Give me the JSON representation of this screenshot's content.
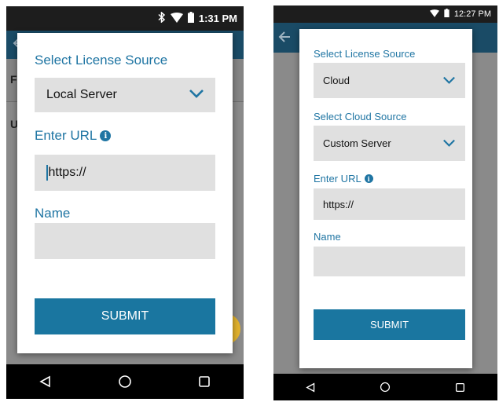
{
  "left": {
    "status": {
      "time": "1:31 PM"
    },
    "behind": {
      "row1_letter": "F",
      "row2_letter": "U"
    },
    "dialog": {
      "license_label": "Select License Source",
      "license_value": "Local Server",
      "url_label": "Enter URL",
      "url_value": "https://",
      "name_label": "Name",
      "name_value": "",
      "submit_label": "SUBMIT"
    }
  },
  "right": {
    "status": {
      "time": "12:27 PM"
    },
    "dialog": {
      "license_label": "Select License Source",
      "license_value": "Cloud",
      "cloud_label": "Select Cloud Source",
      "cloud_value": "Custom Server",
      "url_label": "Enter URL",
      "url_value": "https://",
      "name_label": "Name",
      "name_value": "",
      "submit_label": "SUBMIT"
    }
  },
  "icons": [
    "back-arrow-icon",
    "bluetooth-icon",
    "wifi-icon",
    "battery-icon",
    "chevron-down-icon",
    "info-icon",
    "nav-back-icon",
    "nav-home-icon",
    "nav-recents-icon"
  ],
  "colors": {
    "accent": "#1f75a3",
    "appbar": "#1a4b66",
    "field": "#e0e0e0",
    "submit": "#1a76a0",
    "fab": "#e2b22c"
  }
}
